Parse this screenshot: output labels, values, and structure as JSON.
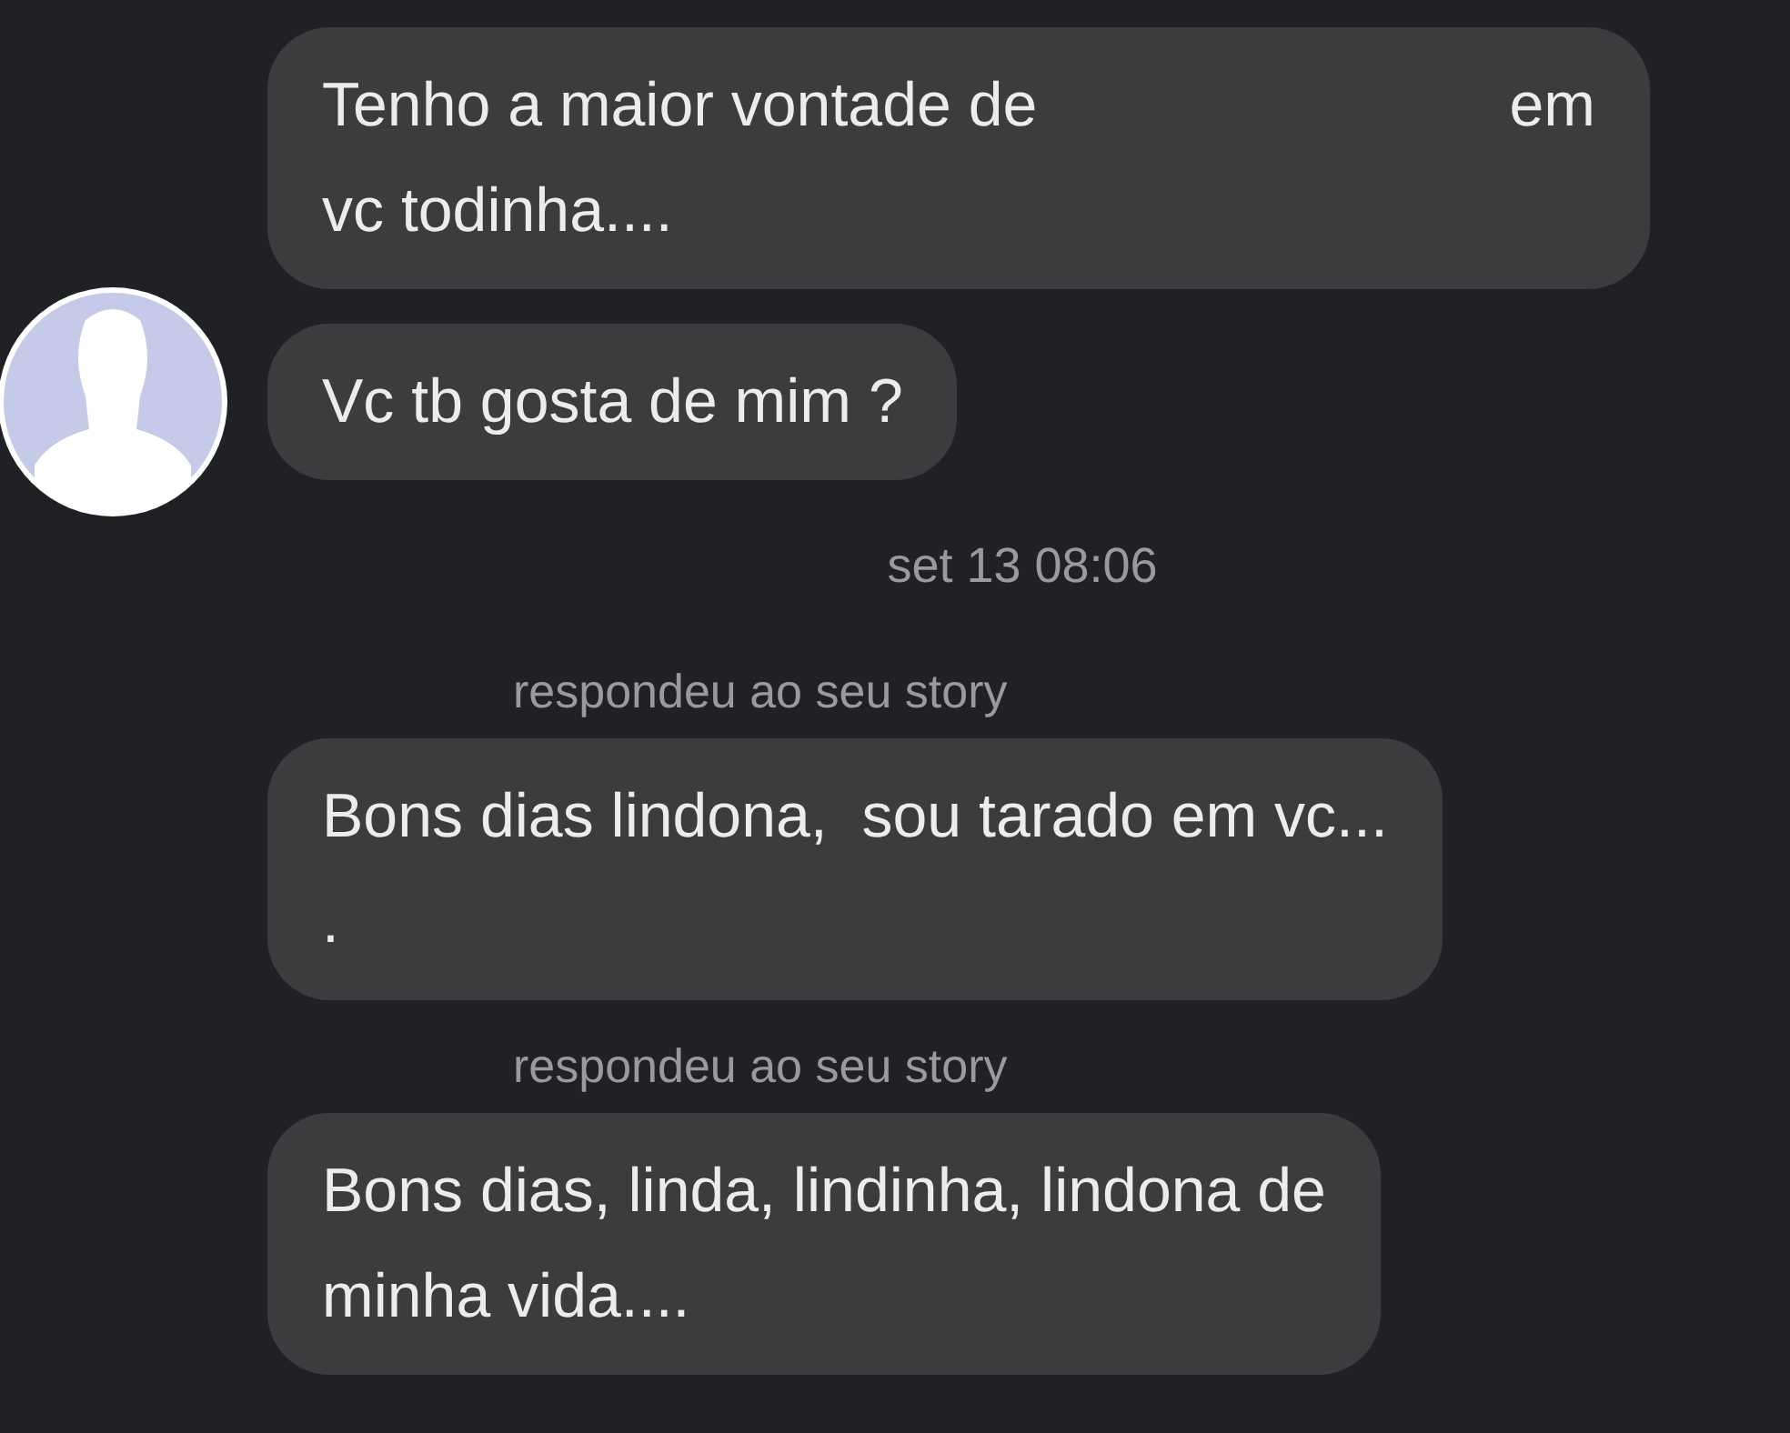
{
  "messages": [
    {
      "kind": "message",
      "avatar": false,
      "lines": [
        [
          "Tenho a maior vontade de",
          "em"
        ],
        [
          "vc todinha...."
        ]
      ]
    },
    {
      "kind": "message",
      "avatar": true,
      "lines": [
        [
          "Vc tb gosta de mim ?"
        ]
      ]
    },
    {
      "kind": "timestamp",
      "text": "set 13 08:06"
    },
    {
      "kind": "message",
      "avatar": false,
      "reply_label": "respondeu ao seu story",
      "lines": [
        [
          "Bons dias lindona,  sou tarado em vc..."
        ],
        [
          "."
        ]
      ]
    },
    {
      "kind": "message",
      "avatar": false,
      "reply_label": "respondeu ao seu story",
      "lines": [
        [
          "Bons dias, linda, lindinha, lindona de"
        ],
        [
          "minha vida...."
        ]
      ]
    }
  ]
}
